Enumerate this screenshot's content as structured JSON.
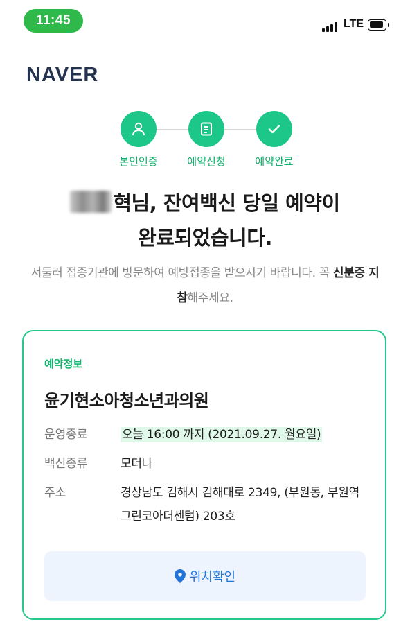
{
  "status_bar": {
    "time": "11:45",
    "network": "LTE"
  },
  "brand": {
    "logo": "NAVER"
  },
  "steps": [
    {
      "label": "본인인증",
      "icon": "person-icon"
    },
    {
      "label": "예약신청",
      "icon": "clipboard-icon"
    },
    {
      "label": "예약완료",
      "icon": "check-icon"
    }
  ],
  "headline": {
    "name_suffix": "혁님, 잔여백신 당일 예약이",
    "line2": "완료되었습니다."
  },
  "subtext": {
    "part1": "서둘러 접종기관에 방문하여 예방접종을 받으시기 바랍니다. 꼭 ",
    "bold1": "신분증 지참",
    "part2": "해주세요."
  },
  "reservation": {
    "section_label": "예약정보",
    "clinic_name": "윤기현소아청소년과의원",
    "rows": [
      {
        "key": "운영종료",
        "value": "오늘 16:00 까지 (2021.09.27. 월요일)"
      },
      {
        "key": "백신종류",
        "value": "모더나"
      },
      {
        "key": "주소",
        "value": "경상남도 김해시 김해대로 2349, (부원동, 부원역그린코아더센텀) 203호"
      }
    ],
    "location_button": "위치확인"
  },
  "colors": {
    "accent_green": "#1dc78a",
    "status_green": "#2fb94a",
    "link_blue": "#2273d8",
    "logo_navy": "#23324d"
  }
}
